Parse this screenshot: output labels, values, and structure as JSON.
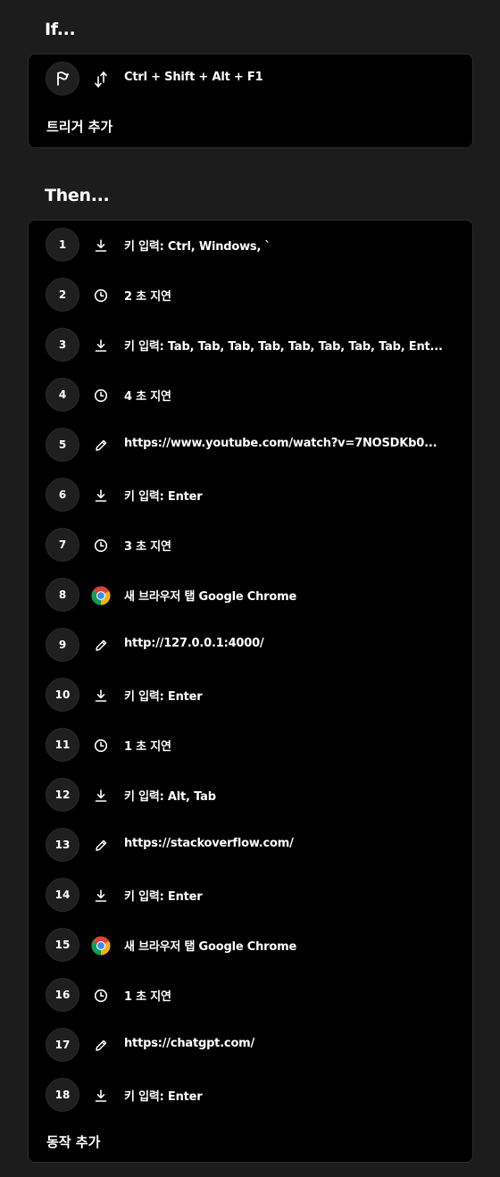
{
  "if_section": {
    "heading": "If...",
    "trigger": {
      "icon": "updown-arrows-icon",
      "label": "Ctrl + Shift + Alt + F1"
    },
    "add_trigger_label": "트리거 추가"
  },
  "then_section": {
    "heading": "Then...",
    "actions": [
      {
        "num": "1",
        "icon": "keystroke-icon",
        "label": "키 입력: Ctrl, Windows, `"
      },
      {
        "num": "2",
        "icon": "clock-icon",
        "label": "2 초 지연"
      },
      {
        "num": "3",
        "icon": "keystroke-icon",
        "label": "키 입력: Tab, Tab, Tab, Tab, Tab, Tab, Tab, Tab, Ent..."
      },
      {
        "num": "4",
        "icon": "clock-icon",
        "label": "4 초 지연"
      },
      {
        "num": "5",
        "icon": "pencil-icon",
        "label": "https://www.youtube.com/watch?v=7NOSDKb0..."
      },
      {
        "num": "6",
        "icon": "keystroke-icon",
        "label": "키 입력: Enter"
      },
      {
        "num": "7",
        "icon": "clock-icon",
        "label": "3 초 지연"
      },
      {
        "num": "8",
        "icon": "chrome-icon",
        "label": "새 브라우저 탭 Google Chrome"
      },
      {
        "num": "9",
        "icon": "pencil-icon",
        "label": "http://127.0.0.1:4000/"
      },
      {
        "num": "10",
        "icon": "keystroke-icon",
        "label": "키 입력: Enter"
      },
      {
        "num": "11",
        "icon": "clock-icon",
        "label": "1 초 지연"
      },
      {
        "num": "12",
        "icon": "keystroke-icon",
        "label": "키 입력: Alt, Tab"
      },
      {
        "num": "13",
        "icon": "pencil-icon",
        "label": "https://stackoverflow.com/"
      },
      {
        "num": "14",
        "icon": "keystroke-icon",
        "label": "키 입력: Enter"
      },
      {
        "num": "15",
        "icon": "chrome-icon",
        "label": "새 브라우저 탭 Google Chrome"
      },
      {
        "num": "16",
        "icon": "clock-icon",
        "label": "1 초 지연"
      },
      {
        "num": "17",
        "icon": "pencil-icon",
        "label": "https://chatgpt.com/"
      },
      {
        "num": "18",
        "icon": "keystroke-icon",
        "label": "키 입력: Enter"
      }
    ],
    "add_action_label": "동작 추가"
  }
}
